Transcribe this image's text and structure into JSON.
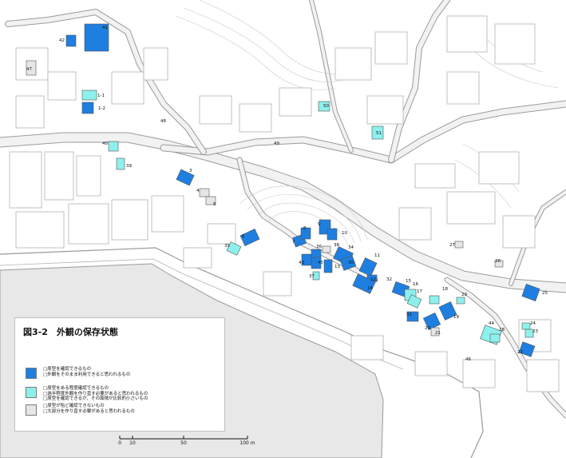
{
  "colors": {
    "sea": "#e8e8e8",
    "sea_edge": "#9a9a9a",
    "road": "#f2f2f2",
    "road_edge": "#9b9b9b",
    "outline": "#a8a8a8",
    "class_a": "#1e7fe0",
    "class_b": "#8ef0ec",
    "class_c": "#e6e6e6"
  },
  "legend": {
    "title": "図3-2　外観の保存状態",
    "items": [
      {
        "color": "#1e7fe0",
        "lines": [
          "□原型を確認できるもの",
          "□外観をそのまま利用できると思われるもの"
        ]
      },
      {
        "color": "#8ef0ec",
        "lines": [
          "□原型をある程度確認できるもの",
          "□過半程度外観を作り直す必要があると思われるもの",
          "□原型を確認できるが、その面積が比較的小さいもの"
        ]
      },
      {
        "color": "#e6e6e6",
        "lines": [
          "□原型が殆ど確認できないもの",
          "□大部分を作り直す必要があると思われるもの"
        ]
      }
    ]
  },
  "scale_bar": {
    "ticks": [
      {
        "label": "0",
        "m": 0
      },
      {
        "label": "10",
        "m": 10
      },
      {
        "label": "50",
        "m": 50
      },
      {
        "label": "100 m",
        "m": 100
      }
    ]
  },
  "buildings": [
    {
      "label": "41",
      "class": "a"
    },
    {
      "label": "42",
      "class": "a"
    },
    {
      "label": "47",
      "class": "c"
    },
    {
      "label": "1-1",
      "class": "b"
    },
    {
      "label": "1-2",
      "class": "a"
    },
    {
      "label": "48",
      "class": "c"
    },
    {
      "label": "40",
      "class": "b"
    },
    {
      "label": "39",
      "class": "b"
    },
    {
      "label": "50",
      "class": "b"
    },
    {
      "label": "51",
      "class": "b"
    },
    {
      "label": "49",
      "class": "c"
    },
    {
      "label": "3",
      "class": "a"
    },
    {
      "label": "4",
      "class": "c"
    },
    {
      "label": "5",
      "class": "c"
    },
    {
      "label": "6",
      "class": "a"
    },
    {
      "label": "35",
      "class": "b"
    },
    {
      "label": "7",
      "class": "a"
    },
    {
      "label": "8",
      "class": "a"
    },
    {
      "label": "9",
      "class": "a"
    },
    {
      "label": "10",
      "class": "a"
    },
    {
      "label": "36",
      "class": "a"
    },
    {
      "label": "38",
      "class": "c"
    },
    {
      "label": "34",
      "class": "a"
    },
    {
      "label": "43",
      "class": "a"
    },
    {
      "label": "45",
      "class": "a"
    },
    {
      "label": "13",
      "class": "a"
    },
    {
      "label": "30",
      "class": "a"
    },
    {
      "label": "37",
      "class": "b"
    },
    {
      "label": "11",
      "class": "a"
    },
    {
      "label": "12",
      "class": "a"
    },
    {
      "label": "14",
      "class": "a"
    },
    {
      "label": "32",
      "class": "c"
    },
    {
      "label": "15",
      "class": "a"
    },
    {
      "label": "16",
      "class": "b"
    },
    {
      "label": "17",
      "class": "b"
    },
    {
      "label": "18",
      "class": "b"
    },
    {
      "label": "29",
      "class": "b"
    },
    {
      "label": "31",
      "class": "a"
    },
    {
      "label": "20",
      "class": "a"
    },
    {
      "label": "21",
      "class": "c"
    },
    {
      "label": "19",
      "class": "a"
    },
    {
      "label": "44",
      "class": "b"
    },
    {
      "label": "28",
      "class": "b"
    },
    {
      "label": "24",
      "class": "b"
    },
    {
      "label": "23",
      "class": "b"
    },
    {
      "label": "22",
      "class": "a"
    },
    {
      "label": "25",
      "class": "a"
    },
    {
      "label": "26",
      "class": "c"
    },
    {
      "label": "27",
      "class": "c"
    },
    {
      "label": "46",
      "class": "c"
    }
  ]
}
